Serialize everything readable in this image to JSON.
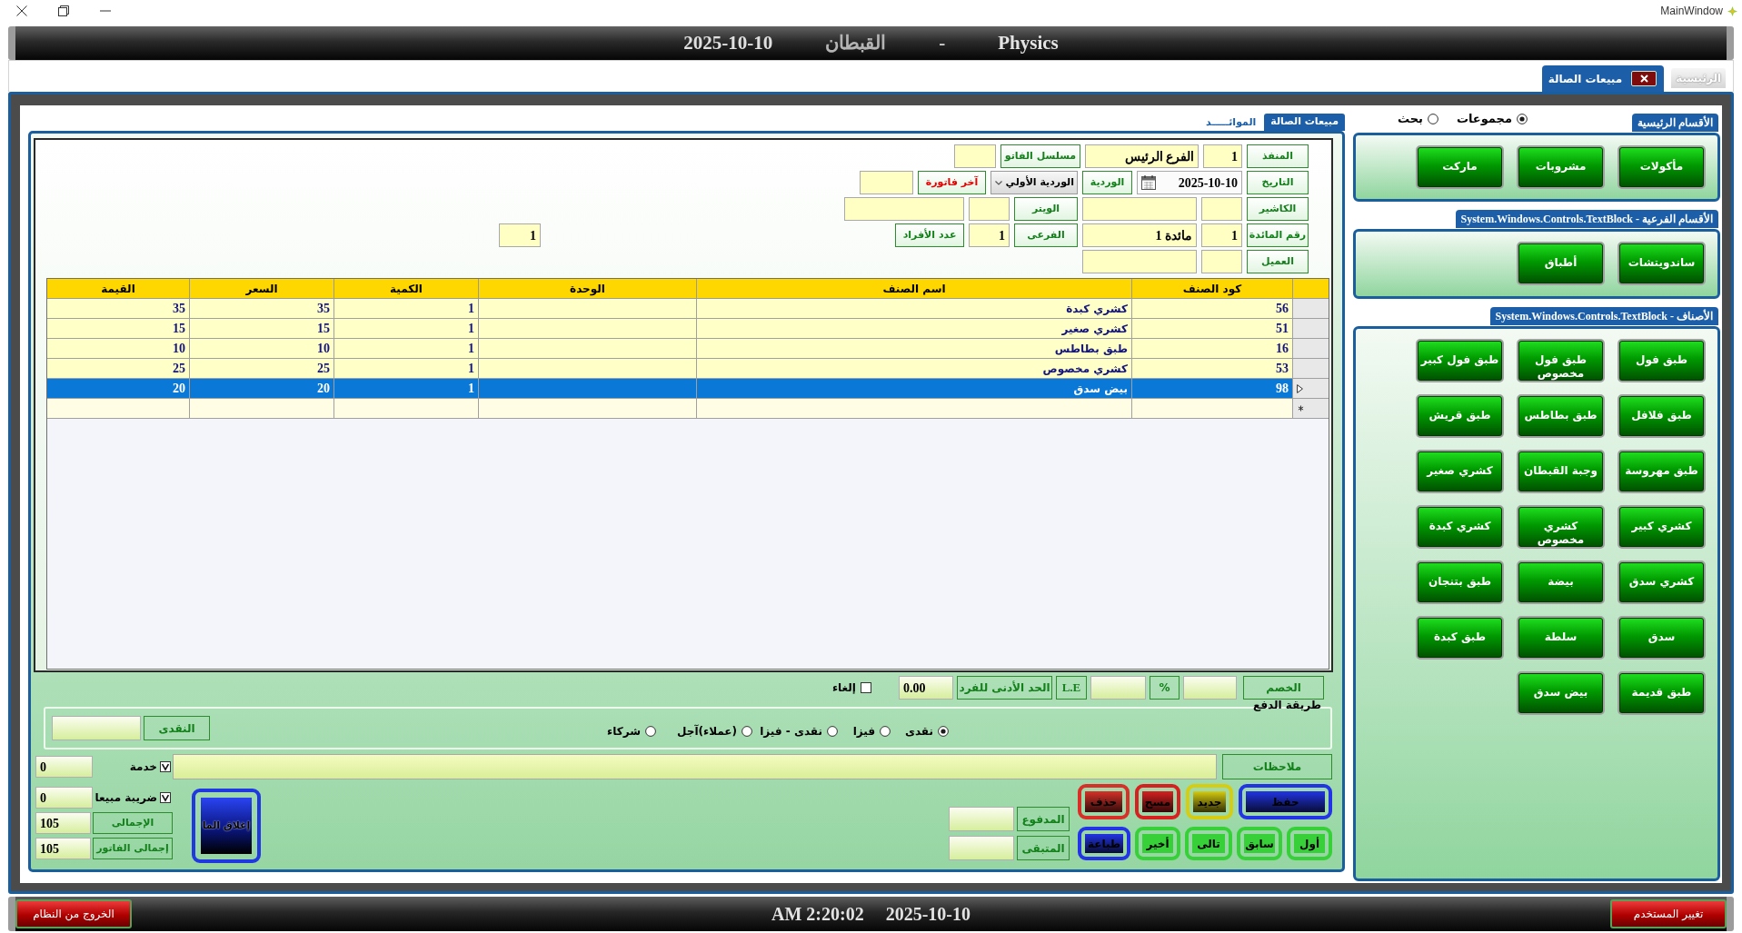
{
  "window": {
    "title": "MainWindow"
  },
  "header": [
    "Physics",
    "-",
    "القبطان",
    "2025-10-10"
  ],
  "tabs": [
    {
      "label": "الرئيسية",
      "selected": false,
      "closable": false
    },
    {
      "label": "مبيعات الصالة",
      "selected": true,
      "closable": true
    }
  ],
  "sales": {
    "tabs": [
      {
        "label": "مبيعات الصالة",
        "selected": true
      },
      {
        "label": "الموائـــــد",
        "selected": false
      }
    ],
    "form": [
      [
        {
          "kind": "label",
          "text": "المنفذ",
          "alert": false
        },
        {
          "kind": "input",
          "value": "1"
        },
        {
          "kind": "input",
          "value": "الفرع الرئيس"
        },
        {
          "kind": "label",
          "text": "مسلسل الفاتو",
          "alert": false
        },
        {
          "kind": "input"
        }
      ],
      [
        {
          "kind": "label",
          "text": "التاريخ",
          "alert": false
        },
        {
          "kind": "date",
          "value": "2025-10-10"
        },
        {
          "kind": "label",
          "text": "الوردية",
          "alert": false
        },
        {
          "kind": "combo",
          "value": "الوردية الأولي"
        },
        {
          "kind": "label",
          "text": "آخر فاتورة",
          "alert": true
        },
        {
          "kind": "input"
        }
      ],
      [
        {
          "kind": "label",
          "text": "الكاشير",
          "alert": false
        },
        {
          "kind": "input"
        },
        {
          "kind": "input"
        },
        {
          "kind": "label",
          "text": "الويتر",
          "alert": false
        },
        {
          "kind": "input"
        },
        {
          "kind": "input"
        }
      ],
      [
        {
          "kind": "label",
          "text": "رقم المائدة",
          "alert": false
        },
        {
          "kind": "input",
          "value": "1"
        },
        {
          "kind": "input",
          "value": "مائدة 1"
        },
        {
          "kind": "label",
          "text": "الفرعى",
          "alert": false
        },
        {
          "kind": "input",
          "value": "1"
        },
        {
          "kind": "label",
          "text": "عدد الأفراد",
          "alert": false
        },
        {
          "kind": "input",
          "value": "1"
        }
      ],
      [
        {
          "kind": "label",
          "text": "العميل",
          "alert": false
        },
        {
          "kind": "input"
        },
        {
          "kind": "input"
        }
      ]
    ],
    "table": {
      "columns": [
        "كود الصنف",
        "اسم الصنف",
        "الوحدة",
        "الكمية",
        "السعر",
        "القيمة"
      ],
      "rows": [
        {
          "code": "56",
          "name": "كشري كبدة",
          "quantity": "1",
          "price": "35",
          "amount": "35",
          "selected": false
        },
        {
          "code": "51",
          "name": "كشري صغير",
          "quantity": "1",
          "price": "15",
          "amount": "15",
          "selected": false
        },
        {
          "code": "16",
          "name": "طبق بطاطس",
          "quantity": "1",
          "price": "10",
          "amount": "10",
          "selected": false
        },
        {
          "code": "53",
          "name": "كشري مخصوص",
          "quantity": "1",
          "price": "25",
          "amount": "25",
          "selected": false
        },
        {
          "code": "98",
          "name": "بيض سدق",
          "quantity": "1",
          "price": "20",
          "amount": "20",
          "selected": true
        }
      ]
    },
    "discount": {
      "label": "الخصم",
      "percent": "%",
      "currency": "L.E",
      "minimum_label": "الحد الأدنى للفرد",
      "minimum": "0.00",
      "cancel": {
        "label": "إلغاء",
        "checked": false
      }
    },
    "payment": {
      "title": "طريقة الدفع",
      "options": [
        {
          "label": "نقدى",
          "selected": true
        },
        {
          "label": "فيزا",
          "selected": false
        },
        {
          "label": "نقدى - فيزا",
          "selected": false
        },
        {
          "label": "(عملاء)آجل",
          "selected": false
        },
        {
          "label": "شركاء",
          "selected": false
        }
      ],
      "cash_label": "النقدى"
    },
    "notes": {
      "label": "ملاحظات"
    },
    "extras": [
      {
        "kind": "checkbox",
        "label": "خدمة",
        "checked": true,
        "value": "0"
      },
      {
        "kind": "checkbox",
        "label": "ضريبة مبيعا",
        "checked": true,
        "value": "0"
      },
      {
        "kind": "total",
        "label": "الإجمالى",
        "value": "105"
      },
      {
        "kind": "total",
        "label": "إجمالى الفاتور",
        "value": "105"
      }
    ],
    "actions": [
      {
        "label": "حفظ",
        "color": "#2234e6",
        "kind": "gradient"
      },
      {
        "label": "جديد",
        "color": "#d6cc10",
        "kind": "gradient"
      },
      {
        "label": "مسح",
        "color": "#d82020",
        "kind": "gradient"
      },
      {
        "label": "حذف",
        "color": "#d83028",
        "kind": "gradient"
      }
    ],
    "navigation": [
      {
        "label": "أول",
        "color": "#38d038",
        "kind": "flat"
      },
      {
        "label": "سابق",
        "color": "#38d038",
        "kind": "flat"
      },
      {
        "label": "تالى",
        "color": "#38d038",
        "kind": "flat"
      },
      {
        "label": "أخير",
        "color": "#38d038",
        "kind": "flat"
      },
      {
        "label": "طباعة",
        "color": "#2234e6",
        "kind": "gradient"
      }
    ],
    "payment_fields": [
      {
        "label": "المدفوع"
      },
      {
        "label": "المتبقى"
      }
    ],
    "close_button": {
      "label": "إغلاق الما"
    }
  },
  "menu": {
    "modes": [
      {
        "label": "مجموعات",
        "selected": true
      },
      {
        "label": "بحث",
        "selected": false
      }
    ],
    "sections": [
      {
        "title": "الأقسام الرئيسية",
        "items": [
          "مأكولات",
          "مشروبات",
          "ماركت"
        ]
      },
      {
        "title": "الأقسام الفرعية - System.Windows.Controls.TextBlock",
        "items": [
          "ساندويتشات",
          "أطباق"
        ]
      },
      {
        "title": "الأصناف - System.Windows.Controls.TextBlock",
        "items": [
          "طبق فول",
          "طبق فول مخصوص",
          "طبق فول كبير",
          "طبق فلافل",
          "طبق بطاطس",
          "طبق قريش",
          "طبق مهروسة",
          "وجبة القبطان",
          "كشري صغير",
          "كشري كبير",
          "كشري مخصوص",
          "كشري كبدة",
          "كشري سدق",
          "بيضة",
          "طبق بتنجان",
          "سدق",
          "سلطة",
          "طبق كبدة",
          "طبق قديمة",
          "بيض سدق"
        ]
      }
    ]
  },
  "status_bar": {
    "buttons": [
      "تغيير المستخدم",
      "الخروج من النظام"
    ],
    "date": "2025-10-10",
    "time": "AM 2:20:02"
  }
}
